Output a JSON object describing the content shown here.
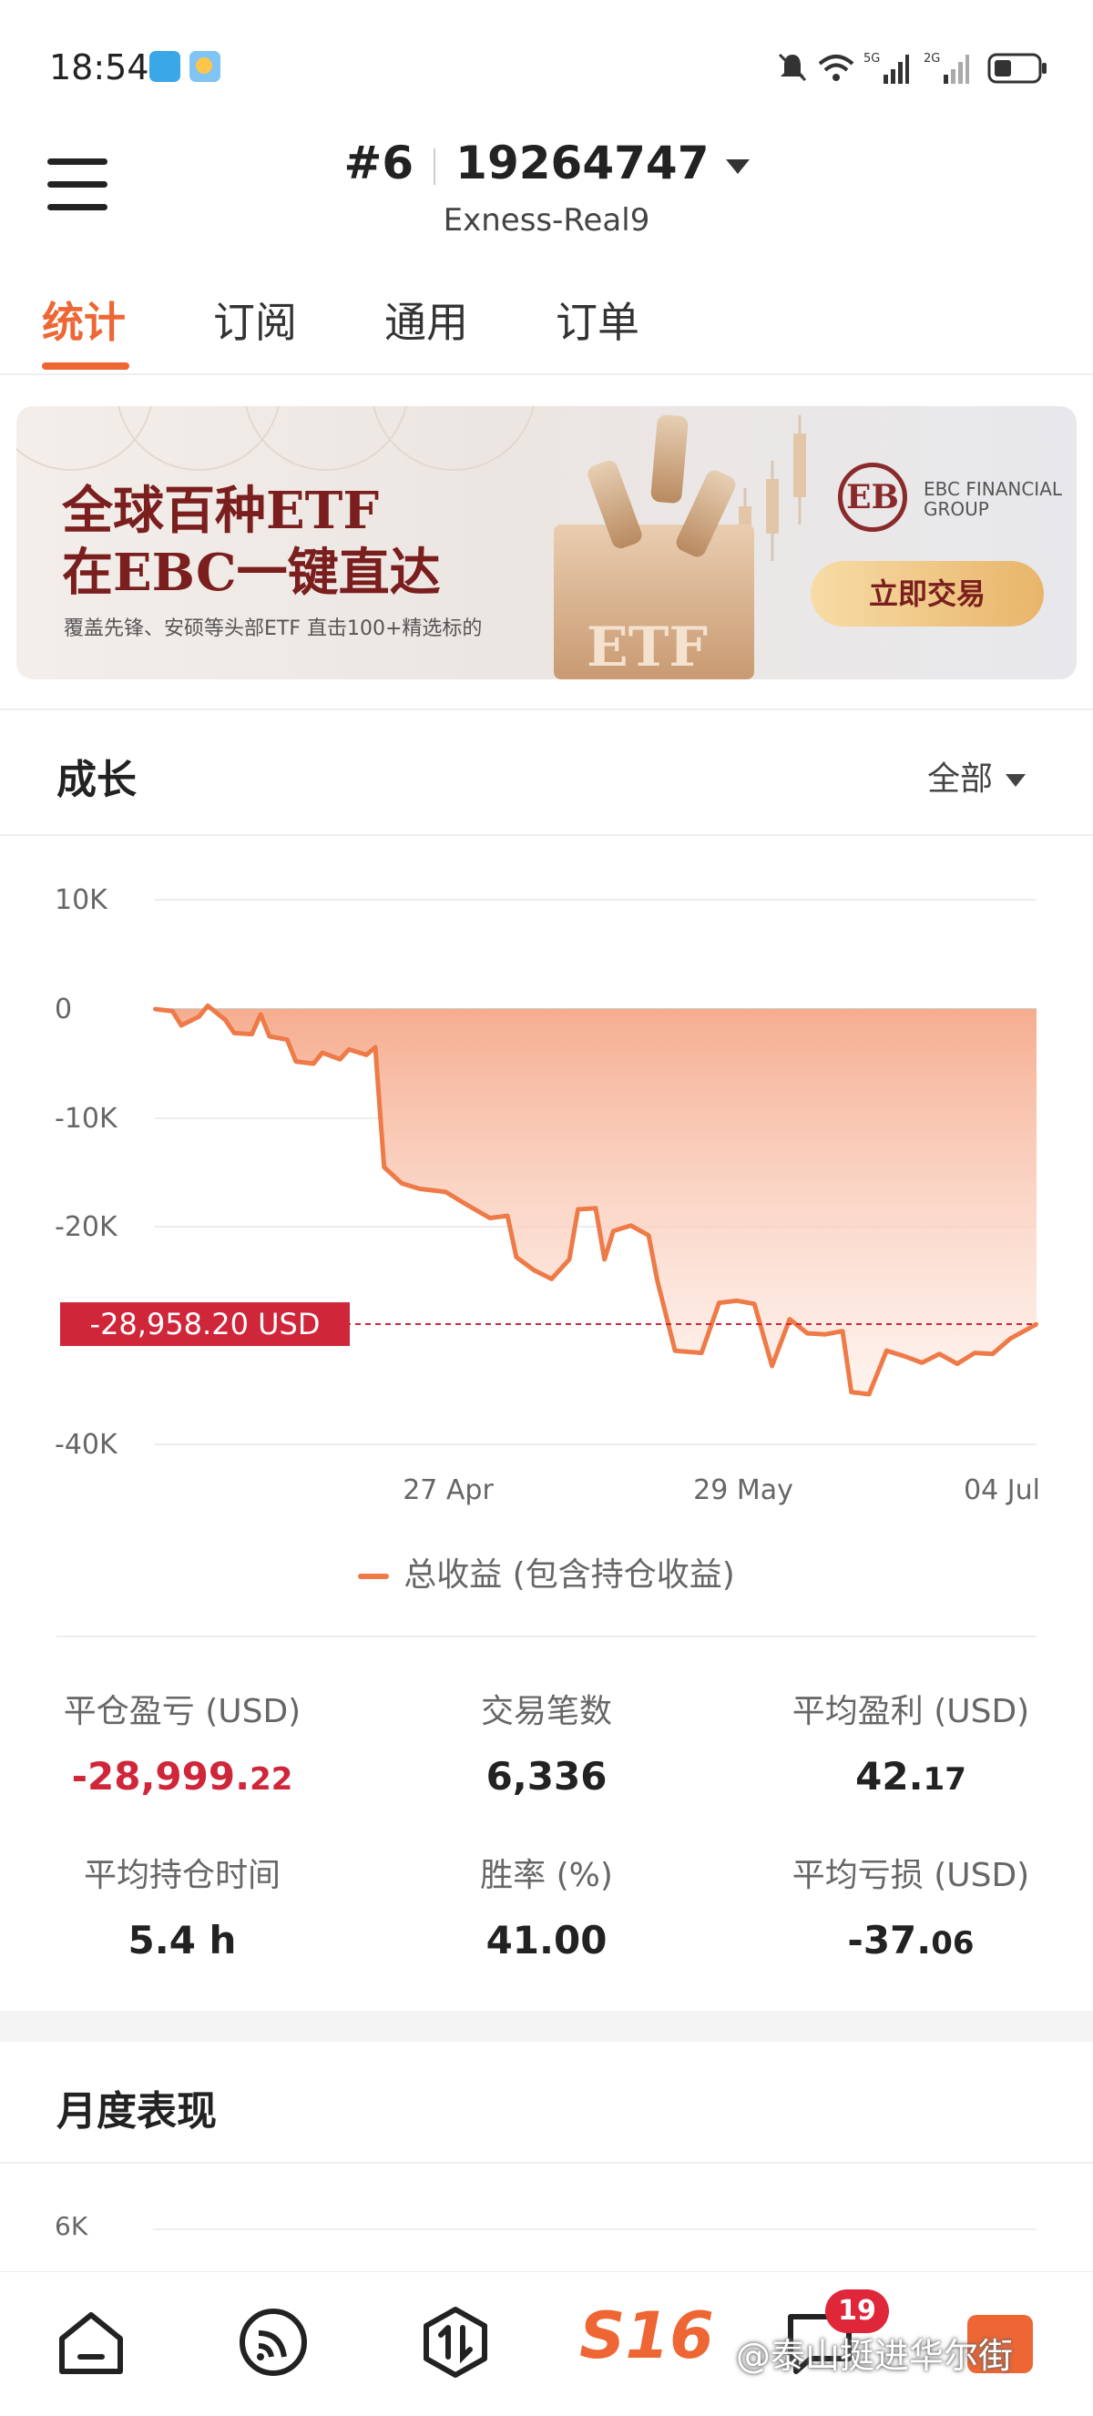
{
  "status_bar": {
    "time": "18:54"
  },
  "header": {
    "account_index": "#6",
    "account_number": "19264747",
    "server": "Exness-Real9"
  },
  "tabs": [
    {
      "label": "统计",
      "active": true
    },
    {
      "label": "订阅",
      "active": false
    },
    {
      "label": "通用",
      "active": false
    },
    {
      "label": "订单",
      "active": false
    }
  ],
  "banner": {
    "title_line1": "全球百种ETF",
    "title_line2": "在EBC一键直达",
    "subtitle": "覆盖先锋、安硕等头部ETF 直击100+精选标的",
    "brand": "EBC FINANCIAL GROUP",
    "brand_mark": "EB",
    "cta": "立即交易",
    "box_text": "ETF"
  },
  "growth": {
    "title": "成长",
    "filter": "全部",
    "current_label": "-28,958.20 USD",
    "legend": "总收益 (包含持仓收益)"
  },
  "chart_data": {
    "type": "area",
    "title": "成长",
    "xlabel": "",
    "ylabel": "",
    "ylim": [
      -40000,
      10000
    ],
    "y_ticks": [
      "10K",
      "0",
      "-10K",
      "-20K",
      "-40K"
    ],
    "x_ticks": [
      "27 Apr",
      "29 May",
      "04 Jul"
    ],
    "current_value": -28958.2,
    "grid": true,
    "legend_position": "bottom",
    "series": [
      {
        "name": "总收益 (包含持仓收益)",
        "color": "#ee7a48",
        "points": [
          [
            "0.00",
            0
          ],
          [
            "0.02",
            -200
          ],
          [
            "0.03",
            -1500
          ],
          [
            "0.05",
            -700
          ],
          [
            "0.06",
            300
          ],
          [
            "0.08",
            -1000
          ],
          [
            "0.09",
            -2200
          ],
          [
            "0.11",
            -2300
          ],
          [
            "0.12",
            -500
          ],
          [
            "0.13",
            -2500
          ],
          [
            "0.15",
            -2800
          ],
          [
            "0.16",
            -4800
          ],
          [
            "0.18",
            -5000
          ],
          [
            "0.19",
            -4000
          ],
          [
            "0.21",
            -4600
          ],
          [
            "0.22",
            -3700
          ],
          [
            "0.24",
            -4200
          ],
          [
            "0.25",
            -3500
          ],
          [
            "0.26",
            -14500
          ],
          [
            "0.28",
            -16000
          ],
          [
            "0.30",
            -16500
          ],
          [
            "0.33",
            -16800
          ],
          [
            "0.35",
            -17800
          ],
          [
            "0.38",
            -19200
          ],
          [
            "0.40",
            -19000
          ],
          [
            "0.41",
            -22800
          ],
          [
            "0.43",
            -24000
          ],
          [
            "0.45",
            -24800
          ],
          [
            "0.47",
            -23000
          ],
          [
            "0.48",
            -18400
          ],
          [
            "0.50",
            -18300
          ],
          [
            "0.51",
            -23000
          ],
          [
            "0.52",
            -20400
          ],
          [
            "0.54",
            -19900
          ],
          [
            "0.56",
            -20800
          ],
          [
            "0.57",
            -25000
          ],
          [
            "0.59",
            -31400
          ],
          [
            "0.62",
            -31600
          ],
          [
            "0.64",
            -27000
          ],
          [
            "0.66",
            -26800
          ],
          [
            "0.68",
            -27100
          ],
          [
            "0.70",
            -32800
          ],
          [
            "0.72",
            -28500
          ],
          [
            "0.74",
            -29800
          ],
          [
            "0.76",
            -29900
          ],
          [
            "0.78",
            -29600
          ],
          [
            "0.79",
            -35200
          ],
          [
            "0.81",
            -35400
          ],
          [
            "0.83",
            -31400
          ],
          [
            "0.85",
            -31900
          ],
          [
            "0.87",
            -32500
          ],
          [
            "0.89",
            -31700
          ],
          [
            "0.91",
            -32600
          ],
          [
            "0.93",
            -31600
          ],
          [
            "0.95",
            -31700
          ],
          [
            "0.97",
            -30300
          ],
          [
            "1.00",
            -28958.2
          ]
        ]
      }
    ]
  },
  "stats": [
    {
      "label": "平仓盈亏 (USD)",
      "int": "-28,999.",
      "dec": "22",
      "negative": true
    },
    {
      "label": "交易笔数",
      "int": "6,336",
      "dec": "",
      "negative": false
    },
    {
      "label": "平均盈利 (USD)",
      "int": "42.",
      "dec": "17",
      "negative": false
    },
    {
      "label": "平均持仓时间",
      "int": "5.4 h",
      "dec": "",
      "negative": false
    },
    {
      "label": "胜率 (%)",
      "int": "41.00",
      "dec": "",
      "negative": false
    },
    {
      "label": "平均亏损 (USD)",
      "int": "-37.",
      "dec": "06",
      "negative": false
    }
  ],
  "monthly": {
    "title": "月度表现",
    "y_tick": "6K"
  },
  "bottom_nav": {
    "logo": "S16",
    "badge": "19",
    "icons": [
      "home-icon",
      "signal-icon",
      "trade-icon",
      "logo",
      "chat-icon",
      "profile-icon"
    ]
  },
  "watermark": "@泰山挺进华尔街"
}
